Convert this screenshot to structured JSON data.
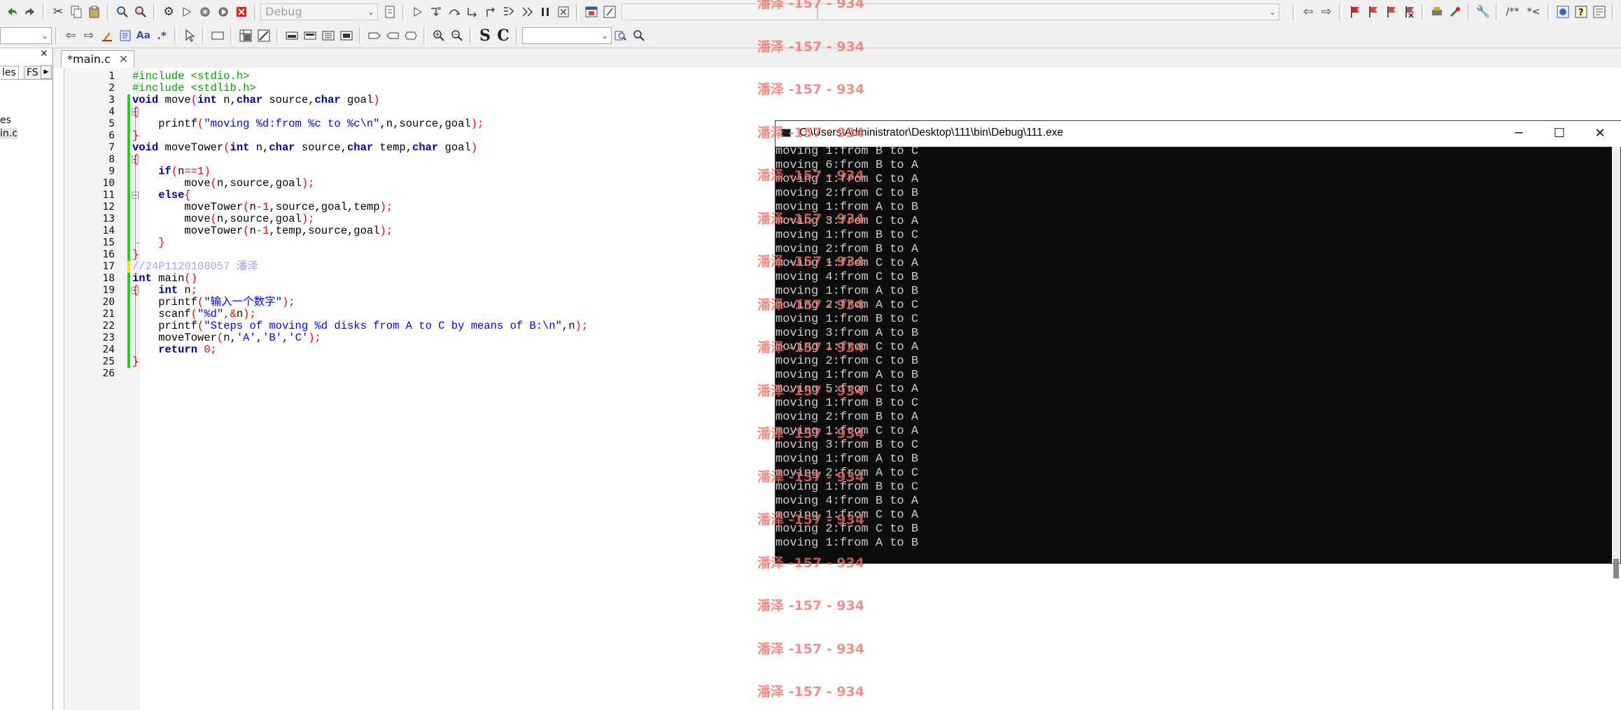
{
  "toolbar1": {
    "build_target": "Debug",
    "icons": [
      "undo-icon",
      "redo-icon",
      "cut-icon",
      "copy-icon",
      "paste-icon",
      "find-icon",
      "replace-icon",
      "settings-icon",
      "run-icon",
      "build-icon",
      "build-run-icon",
      "abort-icon",
      "target-options-icon",
      "debug-run-icon",
      "step-into-icon",
      "step-over-icon",
      "next-line-icon",
      "step-out-icon",
      "next-instruction-icon",
      "pause-icon",
      "stop-icon",
      "debug-windows-icon",
      "info-icon",
      "nav-back-icon",
      "nav-forward-icon",
      "bookmark-icon",
      "prev-bookmark-icon",
      "next-bookmark-icon",
      "clear-bookmarks-icon",
      "plugin-icon",
      "tools-icon",
      "wrench-icon",
      "doc-block-comment-icon",
      "doc-line-comment-icon",
      "doxy-icon",
      "help-icon",
      "jump-back-icon",
      "jump-forward-icon"
    ],
    "comment_block_label": "/**",
    "comment_line_label": "*<"
  },
  "toolbar2": {
    "icons": [
      "back-icon",
      "forward-icon",
      "highlight-icon",
      "format-icon",
      "match-case-icon",
      "regex-icon",
      "pointer-icon",
      "rect-icon",
      "table-icon",
      "selection-icon",
      "block-icon",
      "list-icon",
      "loop-icon",
      "frame-icon",
      "frame2-icon",
      "box-icon",
      "zoom-in-icon",
      "zoom-out-icon",
      "symbol-search-icon",
      "symbol-replace-icon"
    ],
    "match_case_label": "Aa",
    "regex_label": ".*",
    "s_label": "S",
    "c_label": "C"
  },
  "left_panel": {
    "tab_files": "les",
    "tab_fsymbols": "FS",
    "tree_items": [
      "es",
      "in.c"
    ]
  },
  "editor": {
    "tab_label": "*main.c",
    "line_numbers": [
      "1",
      "2",
      "3",
      "4",
      "5",
      "6",
      "7",
      "8",
      "9",
      "10",
      "11",
      "12",
      "13",
      "14",
      "15",
      "16",
      "17",
      "18",
      "19",
      "20",
      "21",
      "22",
      "23",
      "24",
      "25",
      "26"
    ]
  },
  "code": {
    "l1": "#include <stdio.h>",
    "l2": "#include <stdlib.h>",
    "l3_kw1": "void",
    "l3_fn": " move",
    "l3_p1": "(",
    "l3_kw2": "int",
    "l3_a": " n,",
    "l3_kw3": "char",
    "l3_b": " source,",
    "l3_kw4": "char",
    "l3_c": " goal",
    "l3_p2": ")",
    "l4": "{",
    "l5_fn": "    printf",
    "l5_p1": "(",
    "l5_s": "\"moving %d:from %c to %c\\n\"",
    "l5_rest": ",n,source,goal",
    "l5_p2": ");",
    "l6": "}",
    "l7_kw1": "void",
    "l7_fn": " moveTower",
    "l7_p1": "(",
    "l7_kw2": "int",
    "l7_a": " n,",
    "l7_kw3": "char",
    "l7_b": " source,",
    "l7_kw4": "char",
    "l7_c": " temp,",
    "l7_kw5": "char",
    "l7_d": " goal",
    "l7_p2": ")",
    "l8": "{",
    "l9_kw": "    if",
    "l9_p1": "(",
    "l9_a": "n",
    "l9_op": "==",
    "l9_n": "1",
    "l9_p2": ")",
    "l10_fn": "        move",
    "l10_p1": "(",
    "l10_a": "n,source,goal",
    "l10_p2": ");",
    "l11_kw": "    else",
    "l11_b": "{",
    "l12_fn": "        moveTower",
    "l12_p1": "(",
    "l12_a": "n",
    "l12_op": "-",
    "l12_n": "1",
    "l12_b": ",source,goal,temp",
    "l12_p2": ");",
    "l13_fn": "        move",
    "l13_p1": "(",
    "l13_a": "n,source,goal",
    "l13_p2": ");",
    "l14_fn": "        moveTower",
    "l14_p1": "(",
    "l14_a": "n",
    "l14_op": "-",
    "l14_n": "1",
    "l14_b": ",temp,source,goal",
    "l14_p2": ");",
    "l15": "    }",
    "l16": "}",
    "l17_cm": "//24P1120108057 潘泽",
    "l18_kw": "int",
    "l18_fn": " main",
    "l18_p": "()",
    "l19_b": "{",
    "l19_kw": "   int",
    "l19_a": " n",
    "l19_p": ";",
    "l20_fn": "    printf",
    "l20_p1": "(",
    "l20_s": "\"输入一个数字\"",
    "l20_p2": ");",
    "l21_fn": "    scanf",
    "l21_p1": "(",
    "l21_s": "\"%d\"",
    "l21_op": ",&",
    "l21_a": "n",
    "l21_p2": ");",
    "l22_fn": "    printf",
    "l22_p1": "(",
    "l22_s": "\"Steps of moving %d disks from A to C by means of B:\\n\"",
    "l22_a": ",n",
    "l22_p2": ");",
    "l23_fn": "    moveTower",
    "l23_p1": "(",
    "l23_a": "n,",
    "l23_c1": "'A'",
    "l23_c": ",",
    "l23_c2": "'B'",
    "l23_d": ",",
    "l23_c3": "'C'",
    "l23_p2": ");",
    "l24_kw": "    return",
    "l24_n": " 0",
    "l24_p": ";",
    "l25": "}"
  },
  "console": {
    "title": "C:\\Users\\Administrator\\Desktop\\111\\bin\\Debug\\111.exe",
    "lines": [
      "moving 1:from B to C",
      "moving 6:from B to A",
      "moving 1:from C to A",
      "moving 2:from C to B",
      "moving 1:from A to B",
      "moving 3:from C to A",
      "moving 1:from B to C",
      "moving 2:from B to A",
      "moving 1:from C to A",
      "moving 4:from C to B",
      "moving 1:from A to B",
      "moving 2:from A to C",
      "moving 1:from B to C",
      "moving 3:from A to B",
      "moving 1:from C to A",
      "moving 2:from C to B",
      "moving 1:from A to B",
      "moving 5:from C to A",
      "moving 1:from B to C",
      "moving 2:from B to A",
      "moving 1:from C to A",
      "moving 3:from B to C",
      "moving 1:from A to B",
      "moving 2:from A to C",
      "moving 1:from B to C",
      "moving 4:from B to A",
      "moving 1:from C to A",
      "moving 2:from C to B",
      "moving 1:from A to B"
    ]
  },
  "watermark": "潘泽 -157 - 934",
  "colors": {
    "keyword": "#0000a0",
    "preprocessor": "#00a000",
    "string": "#0000ff",
    "number": "#f00000",
    "comment": "#a0a0ff",
    "change_bar": "#1dd11d",
    "watermark": "#f06e64"
  }
}
